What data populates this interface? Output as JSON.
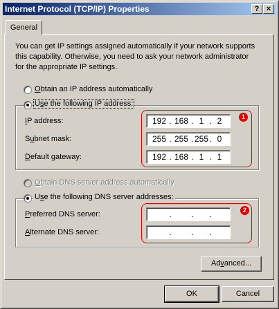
{
  "window": {
    "title": "Internet Protocol (TCP/IP) Properties",
    "help_btn": "?",
    "close_btn": "×"
  },
  "tabs": [
    {
      "label": "General"
    }
  ],
  "intro_text": "You can get IP settings assigned automatically if your network supports this capability. Otherwise, you need to ask your network administrator for the appropriate IP settings.",
  "ip_mode": {
    "auto": {
      "label": "Obtain an IP address automatically",
      "mnemonic": "O",
      "selected": false
    },
    "manual": {
      "label": "Use the following IP address:",
      "mnemonic": "s",
      "selected": true
    }
  },
  "ip_fields": [
    {
      "label_pre": "",
      "mn": "I",
      "label_post": "P address:",
      "octets": [
        "192",
        "168",
        "1",
        "2"
      ]
    },
    {
      "label_pre": "S",
      "mn": "u",
      "label_post": "bnet mask:",
      "octets": [
        "255",
        "255",
        "255",
        "0"
      ]
    },
    {
      "label_pre": "",
      "mn": "D",
      "label_post": "efault gateway:",
      "octets": [
        "192",
        "168",
        "1",
        "1"
      ]
    }
  ],
  "dns_mode": {
    "auto": {
      "label": "Obtain DNS server address automatically",
      "enabled": false,
      "selected": false
    },
    "manual": {
      "label": "Use the following DNS server addresses:",
      "selected": true
    }
  },
  "dns_fields": [
    {
      "label_pre": "",
      "mn": "P",
      "label_post": "referred DNS server:",
      "octets": [
        "",
        "",
        "",
        ""
      ]
    },
    {
      "label_pre": "",
      "mn": "A",
      "label_post": "lternate DNS server:",
      "octets": [
        "",
        "",
        "",
        ""
      ]
    }
  ],
  "annotations": [
    {
      "number": "1"
    },
    {
      "number": "2"
    }
  ],
  "buttons": {
    "advanced": {
      "pre": "Ad",
      "mn": "v",
      "post": "anced..."
    },
    "ok": "OK",
    "cancel": "Cancel"
  },
  "colors": {
    "title_start": "#0a246a",
    "title_end": "#a6caf0",
    "dialog_bg": "#d4d0c8",
    "annotation": "#e00000"
  }
}
